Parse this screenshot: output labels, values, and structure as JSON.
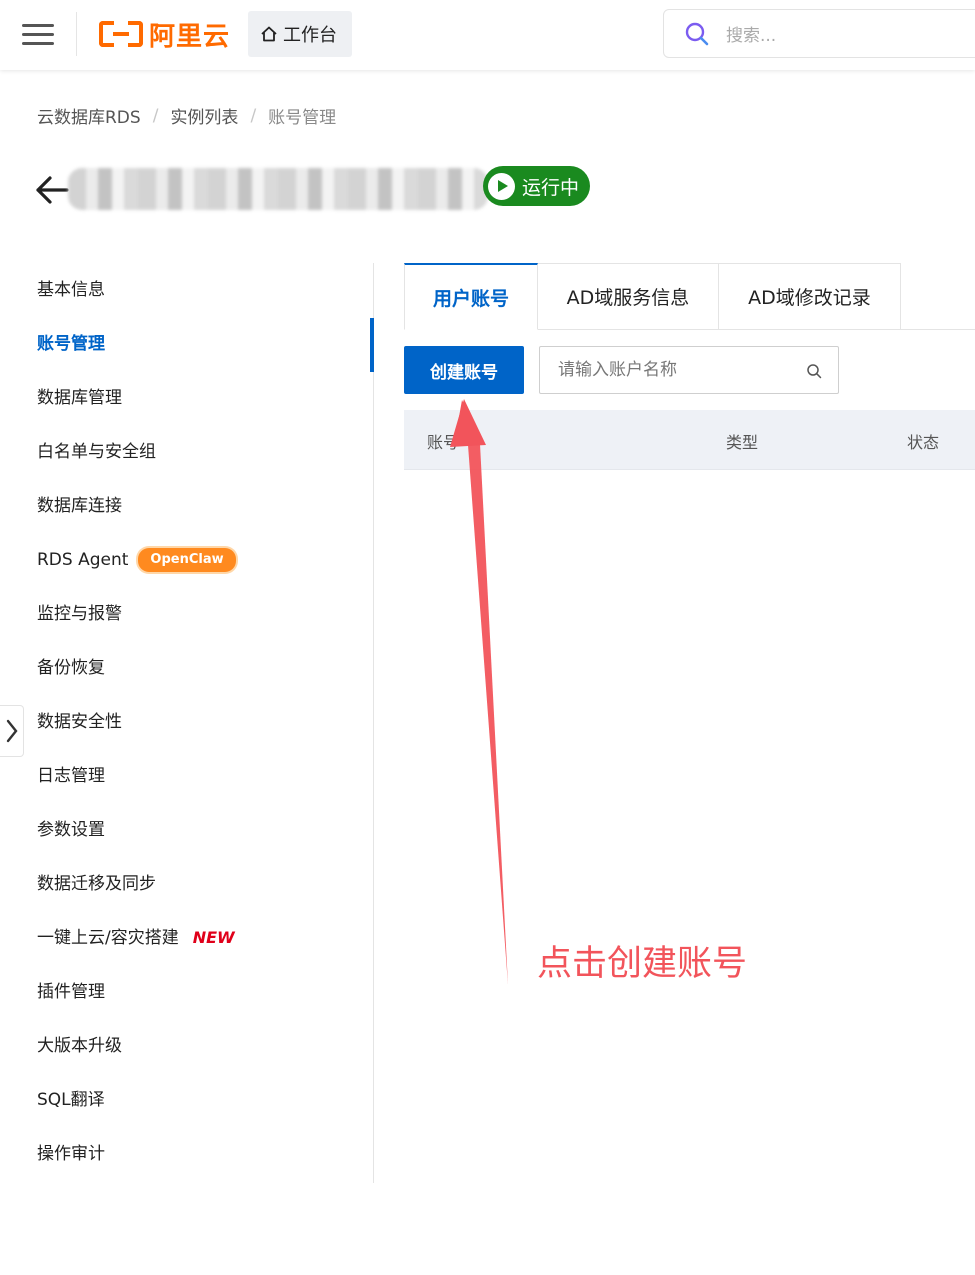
{
  "header": {
    "brand": "阿里云",
    "workbench_label": "工作台",
    "search_placeholder": "搜索..."
  },
  "breadcrumb": [
    "云数据库RDS",
    "实例列表",
    "账号管理"
  ],
  "instance": {
    "status": "运行中",
    "status_color": "#1a8a1f"
  },
  "sidebar": {
    "items": [
      {
        "label": "基本信息"
      },
      {
        "label": "账号管理",
        "active": true
      },
      {
        "label": "数据库管理"
      },
      {
        "label": "白名单与安全组"
      },
      {
        "label": "数据库连接"
      },
      {
        "label": "RDS Agent",
        "badge": "OpenClaw"
      },
      {
        "label": "监控与报警"
      },
      {
        "label": "备份恢复"
      },
      {
        "label": "数据安全性"
      },
      {
        "label": "日志管理"
      },
      {
        "label": "参数设置"
      },
      {
        "label": "数据迁移及同步"
      },
      {
        "label": "一键上云/容灾搭建",
        "badge": "NEW"
      },
      {
        "label": "插件管理"
      },
      {
        "label": "大版本升级"
      },
      {
        "label": "SQL翻译"
      },
      {
        "label": "操作审计"
      }
    ]
  },
  "tabs": [
    {
      "label": "用户账号",
      "active": true
    },
    {
      "label": "AD域服务信息"
    },
    {
      "label": "AD域修改记录"
    }
  ],
  "toolbar": {
    "create_label": "创建账号",
    "search_placeholder": "请输入账户名称"
  },
  "table": {
    "columns": [
      "账号",
      "类型",
      "状态"
    ]
  },
  "annotation": {
    "text": "点击创建账号",
    "color": "#f2545b"
  },
  "colors": {
    "brand": "#ff6a00",
    "primary": "#0064c8"
  }
}
